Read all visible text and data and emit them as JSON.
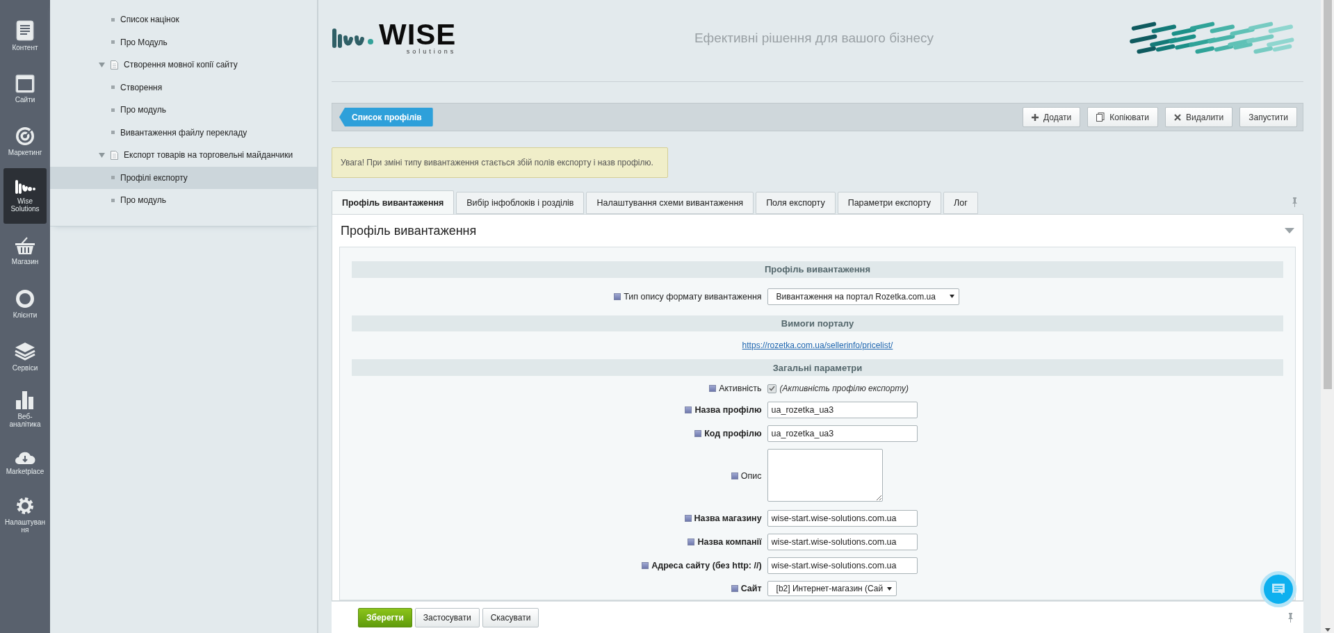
{
  "nav": [
    {
      "label": "Контент",
      "selected": false
    },
    {
      "label": "Сайти",
      "selected": false
    },
    {
      "label": "Маркетинг",
      "selected": false
    },
    {
      "label": "Wise Solutions",
      "selected": true
    },
    {
      "label": "Магазин",
      "selected": false
    },
    {
      "label": "Клієнти",
      "selected": false
    },
    {
      "label": "Сервіси",
      "selected": false
    },
    {
      "label": "Веб-аналітика",
      "selected": false
    },
    {
      "label": "Marketplace",
      "selected": false
    },
    {
      "label": "Налаштування",
      "selected": false
    }
  ],
  "tree": [
    {
      "label": "Список націнок",
      "selected": false
    },
    {
      "label": "Про Модуль",
      "selected": false
    },
    {
      "label": "Створення мовної копії сайту",
      "expanded": true,
      "selected": false,
      "children": [
        {
          "label": "Створення",
          "selected": false
        },
        {
          "label": "Про модуль",
          "selected": false
        },
        {
          "label": "Вивантаження файлу перекладу",
          "selected": false
        }
      ]
    },
    {
      "label": "Експорт товарів на торговельні майданчики",
      "expanded": true,
      "selected": false,
      "children": [
        {
          "label": "Профілі експорту",
          "selected": true
        },
        {
          "label": "Про модуль",
          "selected": false
        }
      ]
    }
  ],
  "header": {
    "logo_text": "WISE",
    "logo_subtext": "solutions",
    "tagline": "Ефективні рішення для вашого бізнесу"
  },
  "toolbar": {
    "back_button": "Список профілів",
    "buttons": [
      {
        "label": "Додати"
      },
      {
        "label": "Копіювати"
      },
      {
        "label": "Видалити"
      },
      {
        "label": "Запустити"
      }
    ]
  },
  "alert": "Увага! При зміні типу вивантаження стається збій полів експорту і назв профілю.",
  "tabs": [
    {
      "label": "Профіль вивантаження",
      "selected": true
    },
    {
      "label": "Вибір інфоблоків і розділів",
      "selected": false
    },
    {
      "label": "Налаштування схеми вивантаження",
      "selected": false
    },
    {
      "label": "Поля експорту",
      "selected": false
    },
    {
      "label": "Параметри експорту",
      "selected": false
    },
    {
      "label": "Лог",
      "selected": false
    }
  ],
  "panel": {
    "title": "Профіль вивантаження",
    "rows": [
      {
        "kind": "section",
        "label": "Профіль вивантаження"
      },
      {
        "kind": "select",
        "label": "Тип опису формату вивантаження",
        "required": false,
        "value": "Вивантаження на портал Rozetka.com.ua"
      },
      {
        "kind": "section",
        "label": "Вимоги порталу"
      },
      {
        "kind": "link",
        "label": "https://rozetka.com.ua/sellerinfo/pricelist/"
      },
      {
        "kind": "section",
        "label": "Загальні параметри"
      },
      {
        "kind": "checkbox",
        "label": "Активність",
        "required": false,
        "checked": true,
        "note": "(Активність профілю експорту)"
      },
      {
        "kind": "input",
        "label": "Назва профілю",
        "required": true,
        "value": "ua_rozetka_ua3"
      },
      {
        "kind": "input",
        "label": "Код профілю",
        "required": true,
        "value": "ua_rozetka_ua3"
      },
      {
        "kind": "textarea",
        "label": "Опис",
        "required": false
      },
      {
        "kind": "input",
        "label": "Назва магазину",
        "required": true,
        "value": "wise-start.wise-solutions.com.ua"
      },
      {
        "kind": "input",
        "label": "Назва компанії",
        "required": true,
        "value": "wise-start.wise-solutions.com.ua"
      },
      {
        "kind": "input",
        "label": "Адреса сайту (без http: //)",
        "required": true,
        "value": "wise-start.wise-solutions.com.ua"
      },
      {
        "kind": "smallselect",
        "label": "Сайт",
        "required": true,
        "value": "[b2] Интернет-магазин (Сай"
      }
    ]
  },
  "footer": {
    "buttons": [
      {
        "label": "Зберегти",
        "kind": "primary"
      },
      {
        "label": "Застосувати",
        "kind": "normal"
      },
      {
        "label": "Скасувати",
        "kind": "normal"
      }
    ]
  }
}
